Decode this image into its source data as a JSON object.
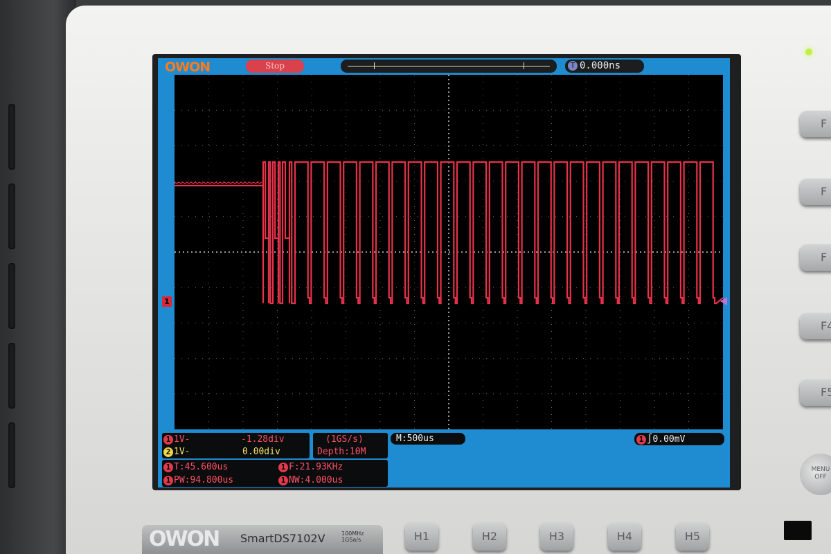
{
  "brand": {
    "screen_logo": "OWON",
    "bottom_logo": "OWON",
    "model": "SmartDS7102V",
    "spec_lines": [
      "100MHz",
      "1GSa/s"
    ]
  },
  "status": {
    "run_state": "Stop"
  },
  "trigger": {
    "position": "0.000ns",
    "channel_badge": "1",
    "level": "0.00mV",
    "badge": "T"
  },
  "timebase": {
    "main": "M:500us"
  },
  "acquisition": {
    "sample_rate": "(1GS/s)",
    "depth": "Depth:10M"
  },
  "channels": [
    {
      "badge": "1",
      "scale": "1V-",
      "offset": "-1.28div",
      "color": "#e23a4a"
    },
    {
      "badge": "2",
      "scale": "1V-",
      "offset": "0.00div",
      "color": "#f0d44a"
    }
  ],
  "measurements": [
    {
      "badge": "1",
      "text": "T:45.600us"
    },
    {
      "badge": "1",
      "text": "F:21.93KHz"
    },
    {
      "badge": "1",
      "text": "PW:94.800us"
    },
    {
      "badge": "1",
      "text": "NW:4.000us"
    }
  ],
  "marker": {
    "ch1_ground": "1"
  },
  "softkeys": [
    "F",
    "F",
    "F",
    "F4",
    "F5"
  ],
  "hkeys": [
    "H1",
    "H2",
    "H3",
    "H4",
    "H5"
  ],
  "menu_button": [
    "MENU",
    "OFF"
  ],
  "trace_color": "#e8324a"
}
